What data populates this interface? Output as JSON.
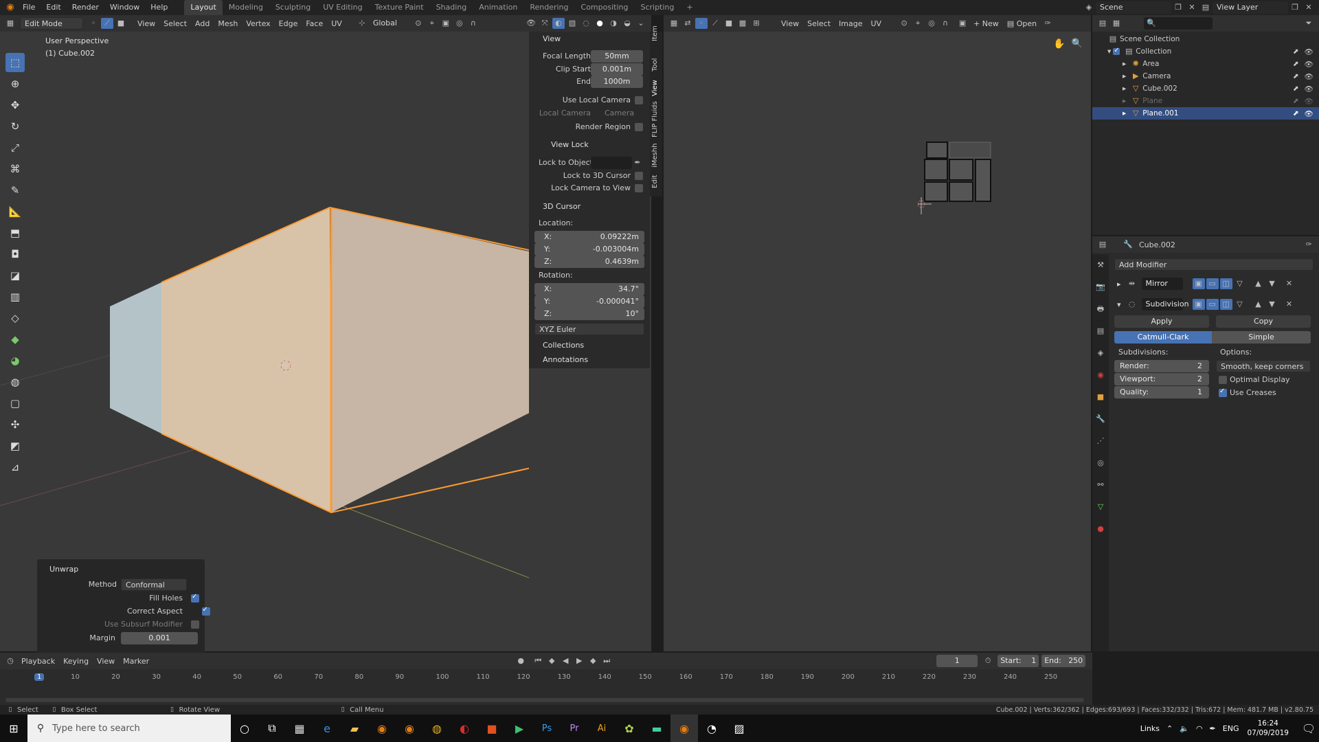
{
  "menubar": {
    "items": [
      "File",
      "Edit",
      "Render",
      "Window",
      "Help"
    ],
    "workspaces": [
      "Layout",
      "Modeling",
      "Sculpting",
      "UV Editing",
      "Texture Paint",
      "Shading",
      "Animation",
      "Rendering",
      "Compositing",
      "Scripting"
    ],
    "add_tab": "+",
    "scene_label": "Scene",
    "view_layer_label": "View Layer"
  },
  "viewport": {
    "mode": "Edit Mode",
    "menus": [
      "View",
      "Select",
      "Add",
      "Mesh",
      "Vertex",
      "Edge",
      "Face",
      "UV"
    ],
    "orientation": "Global",
    "perspective": "User Perspective",
    "object": "(1) Cube.002"
  },
  "npanel": {
    "view_title": "View",
    "focal_length_label": "Focal Length",
    "focal_length": "50mm",
    "clip_start_label": "Clip Start",
    "clip_start": "0.001m",
    "clip_end_label": "End",
    "clip_end": "1000m",
    "use_local_camera": "Use Local Camera",
    "local_camera_label": "Local Camera",
    "local_camera_value": "Camera",
    "render_region": "Render Region",
    "view_lock_title": "View Lock",
    "lock_to_object": "Lock to Object",
    "lock_to_cursor": "Lock to 3D Cursor",
    "lock_camera": "Lock Camera to View",
    "cursor_title": "3D Cursor",
    "location_label": "Location:",
    "loc_x": "0.09222m",
    "loc_y": "-0.003004m",
    "loc_z": "0.4639m",
    "rotation_label": "Rotation:",
    "rot_x": "34.7°",
    "rot_y": "-0.000041°",
    "rot_z": "10°",
    "rotation_mode": "XYZ Euler",
    "collections": "Collections",
    "annotations": "Annotations",
    "axis_x": "X:",
    "axis_y": "Y:",
    "axis_z": "Z:",
    "side_tabs": [
      "Item",
      "Tool",
      "View",
      "FLIP Fluids",
      "iMeshh",
      "Edit"
    ]
  },
  "unwrap": {
    "title": "Unwrap",
    "method_label": "Method",
    "method": "Conformal",
    "fill_holes": "Fill Holes",
    "correct_aspect": "Correct Aspect",
    "use_subsurf": "Use Subsurf Modifier",
    "margin_label": "Margin",
    "margin": "0.001"
  },
  "uv_editor": {
    "menus": [
      "View",
      "Select",
      "Image",
      "UV"
    ],
    "new_label": "New",
    "open_label": "Open"
  },
  "outliner": {
    "root": "Scene Collection",
    "collection": "Collection",
    "items": [
      {
        "name": "Area",
        "icon": "light-icon",
        "selected": false,
        "dim": false
      },
      {
        "name": "Camera",
        "icon": "camera-icon",
        "selected": false,
        "dim": false
      },
      {
        "name": "Cube.002",
        "icon": "mesh-icon",
        "selected": false,
        "dim": false
      },
      {
        "name": "Plane",
        "icon": "mesh-icon",
        "selected": false,
        "dim": true
      },
      {
        "name": "Plane.001",
        "icon": "mesh-icon",
        "selected": true,
        "dim": false
      }
    ]
  },
  "properties": {
    "object_name": "Cube.002",
    "add_modifier": "Add Modifier",
    "mirror_name": "Mirror",
    "subdivision_name": "Subdivision",
    "apply": "Apply",
    "copy": "Copy",
    "catmull": "Catmull-Clark",
    "simple": "Simple",
    "subdivisions_label": "Subdivisions:",
    "options_label": "Options:",
    "render_label": "Render:",
    "render_value": "2",
    "viewport_label": "Viewport:",
    "viewport_value": "2",
    "quality_label": "Quality:",
    "quality_value": "1",
    "smooth_option": "Smooth, keep corners",
    "optimal_display": "Optimal Display",
    "use_creases": "Use Creases"
  },
  "timeline": {
    "menus": [
      "Playback",
      "Keying",
      "View",
      "Marker"
    ],
    "current_frame": "1",
    "start_label": "Start:",
    "start": "1",
    "end_label": "End:",
    "end": "250",
    "ticks": [
      "1",
      "10",
      "20",
      "30",
      "40",
      "50",
      "60",
      "70",
      "80",
      "90",
      "100",
      "110",
      "120",
      "130",
      "140",
      "150",
      "160",
      "170",
      "180",
      "190",
      "200",
      "210",
      "220",
      "230",
      "240",
      "250"
    ]
  },
  "statusbar": {
    "select": "Select",
    "box_select": "Box Select",
    "rotate_view": "Rotate View",
    "call_menu": "Call Menu",
    "stats": "Cube.002 | Verts:362/362 | Edges:693/693 | Faces:332/332 | Tris:672 | Mem: 481.7 MB | v2.80.75"
  },
  "taskbar": {
    "search_placeholder": "Type here to search",
    "links": "Links",
    "lang": "ENG",
    "time": "16:24",
    "date": "07/09/2019"
  },
  "colors": {
    "accent": "#4772b3",
    "selection_orange": "#ff8a1a"
  }
}
